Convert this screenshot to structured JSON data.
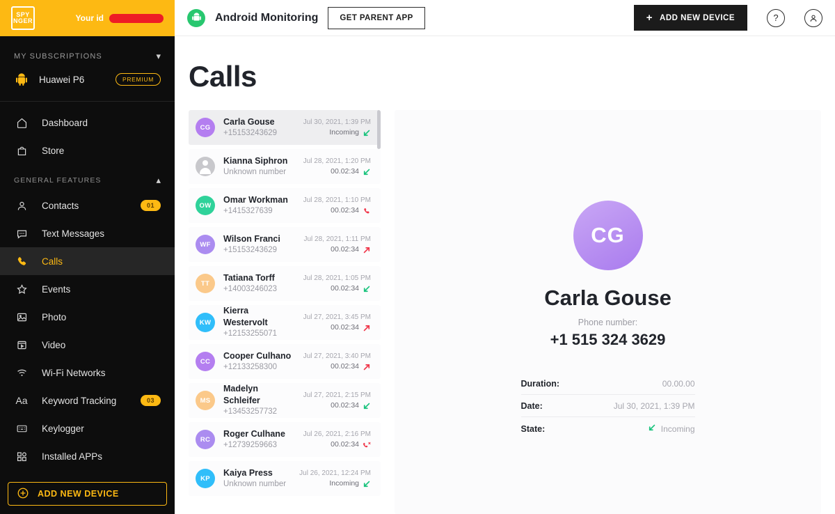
{
  "brand": {
    "logo_line1": "SPY",
    "logo_line2": "NGER",
    "your_id_label": "Your id"
  },
  "sidebar": {
    "subscriptions_heading": "MY SUBSCRIPTIONS",
    "device": {
      "name": "Huawei P6",
      "tag": "PREMIUM",
      "icon": "android-icon"
    },
    "general_heading": "GENERAL FEATURES",
    "top_items": [
      {
        "label": "Dashboard",
        "icon": "home-icon"
      },
      {
        "label": "Store",
        "icon": "bag-icon"
      }
    ],
    "items": [
      {
        "label": "Contacts",
        "icon": "person-icon",
        "badge": "01"
      },
      {
        "label": "Text Messages",
        "icon": "message-icon",
        "badge": ""
      },
      {
        "label": "Calls",
        "icon": "phone-icon",
        "badge": "",
        "active": true
      },
      {
        "label": "Events",
        "icon": "star-icon",
        "badge": ""
      },
      {
        "label": "Photo",
        "icon": "image-icon",
        "badge": ""
      },
      {
        "label": "Video",
        "icon": "video-icon",
        "badge": ""
      },
      {
        "label": "Wi-Fi Networks",
        "icon": "wifi-icon",
        "badge": ""
      },
      {
        "label": "Keyword Tracking",
        "icon": "text-aa-icon",
        "badge": "03"
      },
      {
        "label": "Keylogger",
        "icon": "keyboard-icon",
        "badge": ""
      },
      {
        "label": "Installed APPs",
        "icon": "apps-grid-icon",
        "badge": ""
      }
    ],
    "add_device_label": "ADD NEW DEVICE"
  },
  "topbar": {
    "platform_title": "Android Monitoring",
    "platform_icon": "android-circle-icon",
    "get_parent_app_label": "GET PARENT APP",
    "add_device_label": "ADD NEW DEVICE",
    "plus_icon": "plus-icon",
    "help_icon": "question-mark-icon",
    "account_icon": "user-account-icon"
  },
  "page": {
    "title": "Calls"
  },
  "calls": [
    {
      "name": "Carla Gouse",
      "number": "+15153243629",
      "date": "Jul 30, 2021, 1:39 PM",
      "duration": "Incoming",
      "direction": "incoming",
      "initials": "CG",
      "color": "#b47ef0",
      "selected": true
    },
    {
      "name": "Kianna Siphron",
      "number": "Unknown number",
      "date": "Jul 28, 2021, 1:20 PM",
      "duration": "00.02:34",
      "direction": "incoming",
      "initials": "",
      "color": "#c8c8cc",
      "unknown": true
    },
    {
      "name": "Omar Workman",
      "number": "+1415327639",
      "date": "Jul 28, 2021, 1:10 PM",
      "duration": "00.02:34",
      "direction": "outgoing-call",
      "initials": "OW",
      "color": "#2fd29a"
    },
    {
      "name": "Wilson Franci",
      "number": "+15153243629",
      "date": "Jul 28, 2021, 1:11 PM",
      "duration": "00.02:34",
      "direction": "outgoing",
      "initials": "WF",
      "color": "#ab8cf0"
    },
    {
      "name": "Tatiana Torff",
      "number": "+14003246023",
      "date": "Jul 28, 2021, 1:05 PM",
      "duration": "00.02:34",
      "direction": "incoming",
      "initials": "TT",
      "color": "#fbc98a"
    },
    {
      "name": "Kierra Westervolt",
      "number": "+12153255071",
      "date": "Jul 27, 2021, 3:45 PM",
      "duration": "00.02:34",
      "direction": "outgoing",
      "initials": "KW",
      "color": "#30befa"
    },
    {
      "name": "Cooper Culhano",
      "number": "+12133258300",
      "date": "Jul 27, 2021, 3:40 PM",
      "duration": "00.02:34",
      "direction": "outgoing",
      "initials": "CC",
      "color": "#b47ef0"
    },
    {
      "name": "Madelyn Schleifer",
      "number": "+13453257732",
      "date": "Jul 27, 2021, 2:15 PM",
      "duration": "00.02:34",
      "direction": "incoming",
      "initials": "MS",
      "color": "#fbc98a"
    },
    {
      "name": "Roger Culhane",
      "number": "+12739259663",
      "date": "Jul 26, 2021, 2:16 PM",
      "duration": "00.02:34",
      "direction": "missed",
      "initials": "RC",
      "color": "#ab8cf0"
    },
    {
      "name": "Kaiya Press",
      "number": "Unknown number",
      "date": "Jul 26, 2021, 12:24 PM",
      "duration": "Incoming",
      "direction": "incoming",
      "initials": "KP",
      "color": "#30befa"
    }
  ],
  "detail": {
    "initials": "CG",
    "name": "Carla Gouse",
    "phone_label": "Phone number:",
    "phone": "+1 515 324 3629",
    "rows": [
      {
        "key": "Duration:",
        "value": "00.00.00",
        "icon": ""
      },
      {
        "key": "Date:",
        "value": "Jul 30, 2021, 1:39 PM",
        "icon": ""
      },
      {
        "key": "State:",
        "value": "Incoming",
        "icon": "incoming-arrow-icon"
      }
    ]
  },
  "colors": {
    "brand_yellow": "#FDB913",
    "sidebar_bg": "#0d0d0d",
    "incoming_green": "#19c37d",
    "outgoing_red": "#f0364a"
  }
}
